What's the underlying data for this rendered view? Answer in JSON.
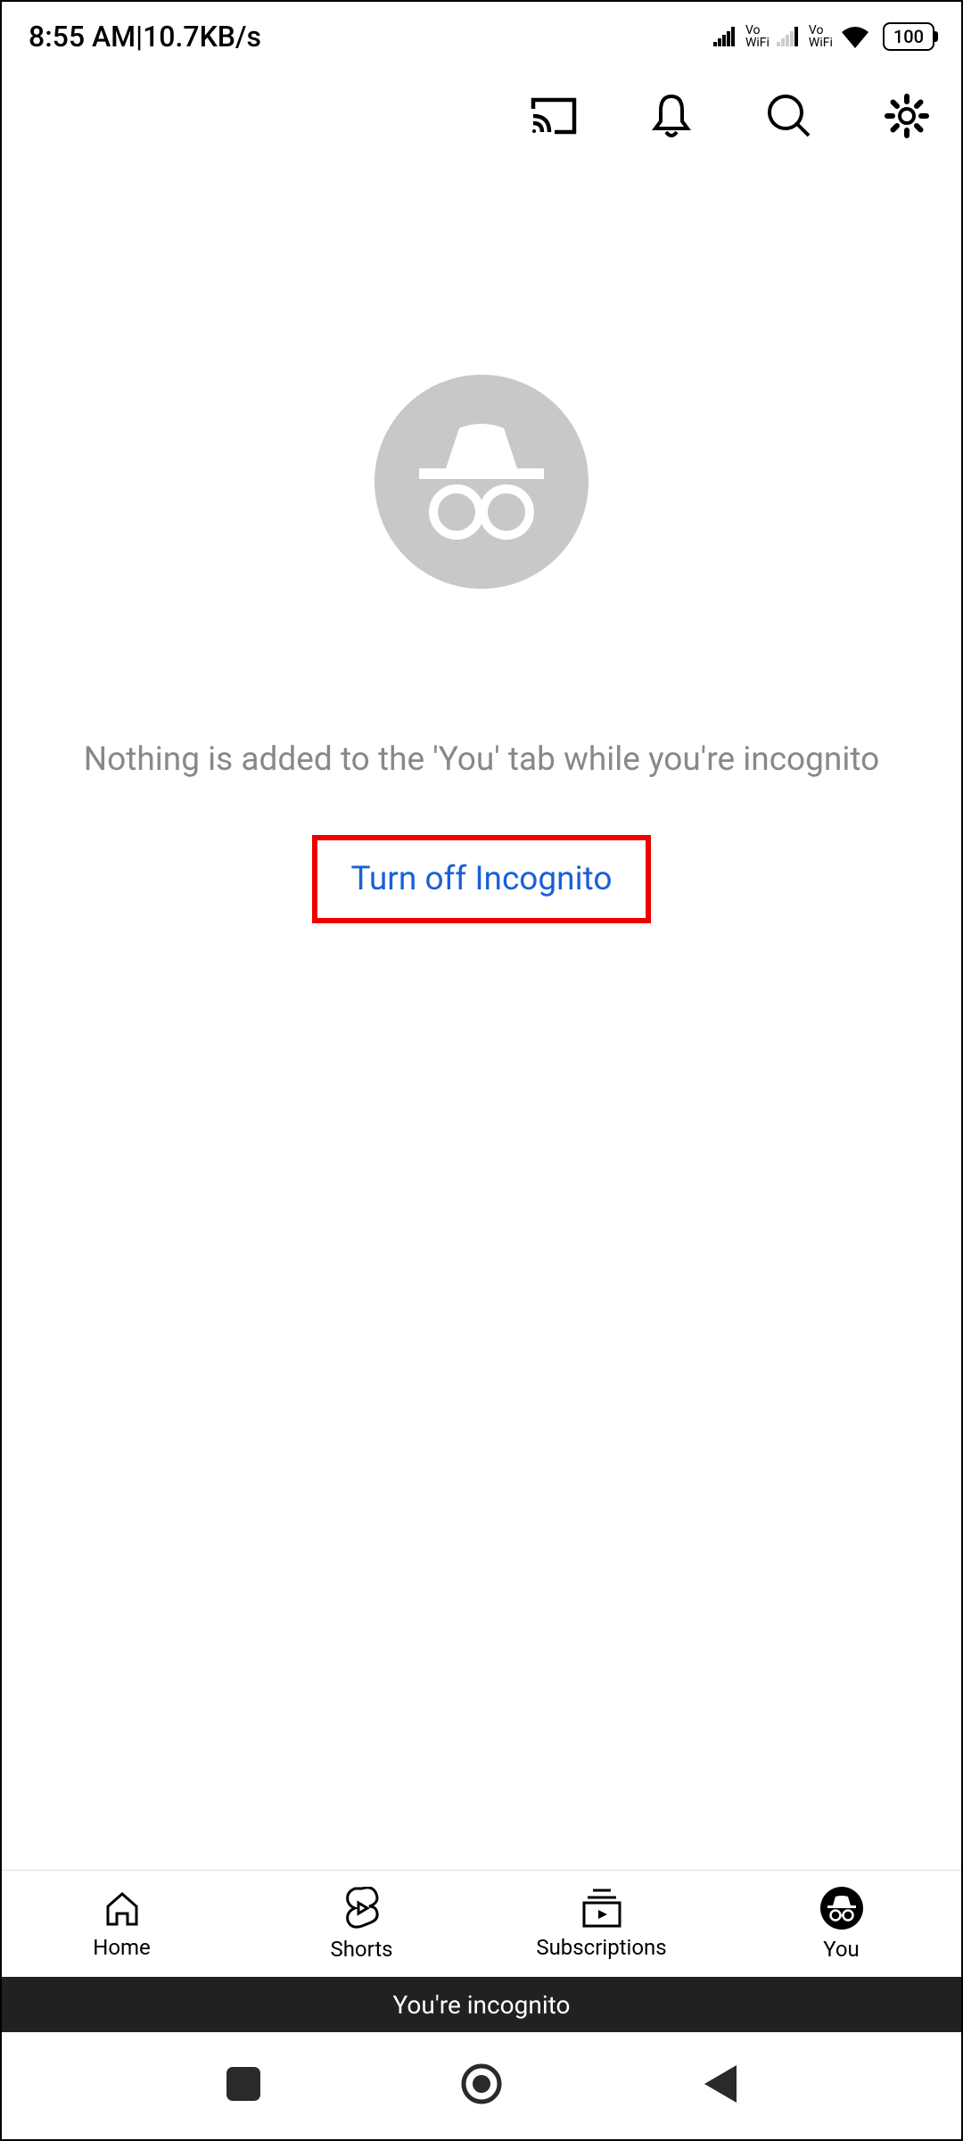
{
  "statusBar": {
    "time": "8:55 AM",
    "separator": " | ",
    "speed": "10.7KB/s",
    "voWifi": "Vo WiFi",
    "battery": "100"
  },
  "main": {
    "message": "Nothing is added to the 'You' tab while you're incognito",
    "turnOffLabel": "Turn off Incognito"
  },
  "bottomNav": {
    "home": "Home",
    "shorts": "Shorts",
    "subscriptions": "Subscriptions",
    "you": "You"
  },
  "banner": {
    "text": "You're incognito"
  }
}
